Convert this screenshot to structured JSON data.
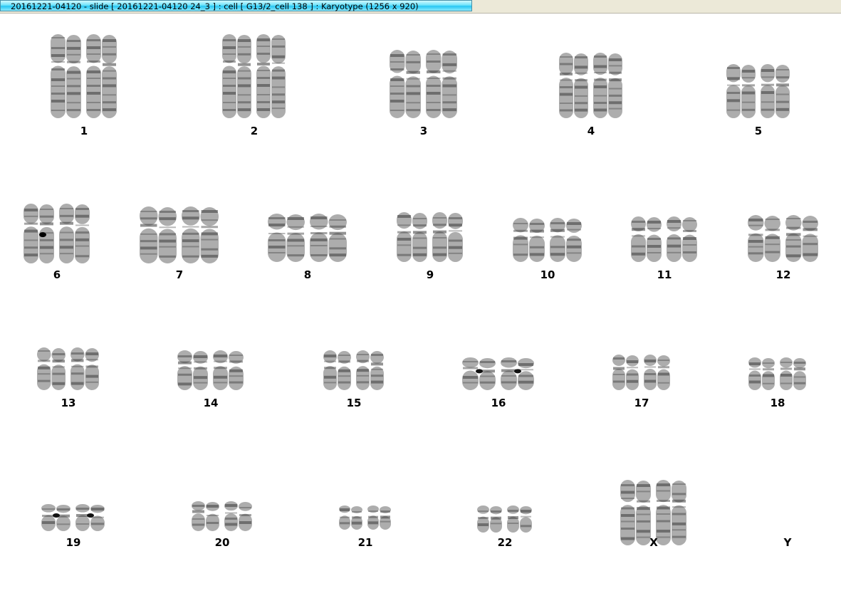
{
  "window": {
    "title": "20161221-04120 - slide [ 20161221-04120 24_3 ] : cell [ G13/2_cell 138 ] : Karyotype  (1256 x 920)"
  },
  "colors": {
    "title_bar_gradient": [
      "#d2f9ff",
      "#27c6f3"
    ],
    "chromosome_ink": "#6a6a6a",
    "background": "#ffffff"
  },
  "karyotype": {
    "chromosomes": [
      {
        "label": "1",
        "count": 2
      },
      {
        "label": "2",
        "count": 2
      },
      {
        "label": "3",
        "count": 2
      },
      {
        "label": "4",
        "count": 2
      },
      {
        "label": "5",
        "count": 2
      },
      {
        "label": "6",
        "count": 2
      },
      {
        "label": "7",
        "count": 2
      },
      {
        "label": "8",
        "count": 2
      },
      {
        "label": "9",
        "count": 2
      },
      {
        "label": "10",
        "count": 2
      },
      {
        "label": "11",
        "count": 2
      },
      {
        "label": "12",
        "count": 2
      },
      {
        "label": "13",
        "count": 2
      },
      {
        "label": "14",
        "count": 2
      },
      {
        "label": "15",
        "count": 2
      },
      {
        "label": "16",
        "count": 2
      },
      {
        "label": "17",
        "count": 2
      },
      {
        "label": "18",
        "count": 2
      },
      {
        "label": "19",
        "count": 2
      },
      {
        "label": "20",
        "count": 2
      },
      {
        "label": "21",
        "count": 2
      },
      {
        "label": "22",
        "count": 2
      },
      {
        "label": "X",
        "count": 2
      },
      {
        "label": "Y",
        "count": 0
      }
    ]
  }
}
